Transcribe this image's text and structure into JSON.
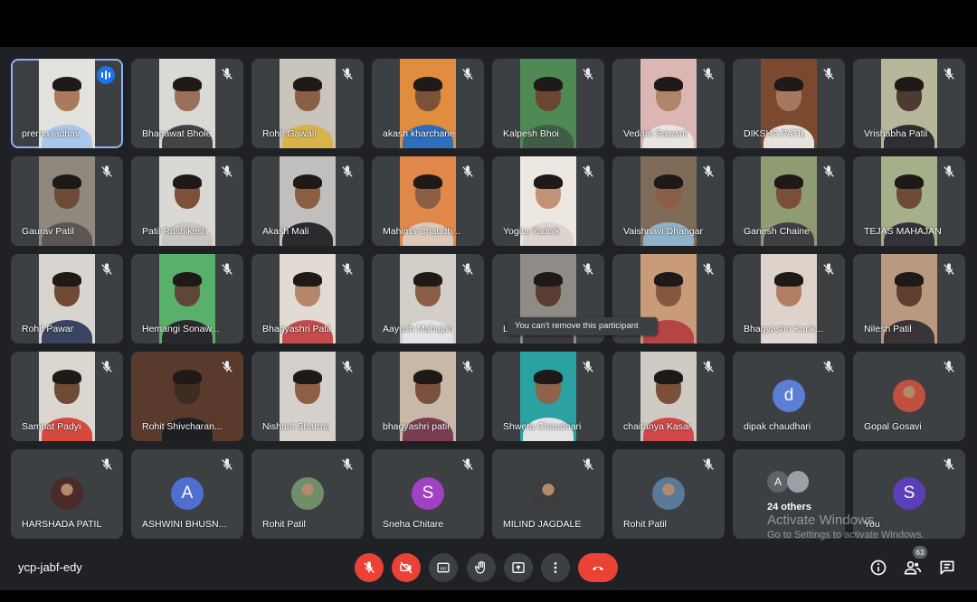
{
  "meeting": {
    "code": "ycp-jabf-edy",
    "participant_count": "63",
    "tooltip": "You can't remove this participant"
  },
  "colors": {
    "background": "#202124",
    "tile": "#3c4043",
    "active_outline": "#8ab4f8",
    "end_call": "#ea4335"
  },
  "tiles": [
    {
      "name": "prerna jadhav",
      "kind": "video",
      "speaking": true,
      "bg": "#e4e2df",
      "skin": "#a97b5c",
      "shirt": "#a9c7ea"
    },
    {
      "name": "Bhagawat Bhole",
      "kind": "video",
      "bg": "#d9dad6",
      "skin": "#9b7058",
      "shirt": "#444447"
    },
    {
      "name": "Rohit Gawali",
      "kind": "video",
      "bg": "#c9c4bc",
      "skin": "#8a5f46",
      "shirt": "#d8b24b"
    },
    {
      "name": "akash kharchane",
      "kind": "video",
      "bg": "#e08d3f",
      "skin": "#7c5136",
      "shirt": "#2d6fbd"
    },
    {
      "name": "Kalpesh Bhoi",
      "kind": "video",
      "bg": "#4f8a55",
      "skin": "#6b4632",
      "shirt": "#3f5e45"
    },
    {
      "name": "Vedant Sawant",
      "kind": "video",
      "bg": "#dbb6b2",
      "skin": "#b08467",
      "shirt": "#e8e4e1"
    },
    {
      "name": "DIKSHA PATIL",
      "kind": "video",
      "bg": "#7b4a2e",
      "skin": "#a5795e",
      "shirt": "#e7e2dd"
    },
    {
      "name": "Vrishabha Patil",
      "kind": "video",
      "bg": "#b7b79b",
      "skin": "#4c3a33",
      "shirt": "#2f2f33"
    },
    {
      "name": "Gaurav Patil",
      "kind": "video",
      "bg": "#8f887f",
      "skin": "#6e4a39",
      "shirt": "#5b5653"
    },
    {
      "name": "Patil Rushikesh",
      "kind": "video",
      "bg": "#d9d8d4",
      "skin": "#7b5139",
      "shirt": "#c9c6c1"
    },
    {
      "name": "Akash Mali",
      "kind": "video",
      "bg": "#c1bfbd",
      "skin": "#8b5d42",
      "shirt": "#2a2a2f"
    },
    {
      "name": "Mahima Chaudh...",
      "kind": "video",
      "bg": "#e0874a",
      "skin": "#8b5f43",
      "shirt": "#d9c9bb"
    },
    {
      "name": "Yogita Yadnik",
      "kind": "video",
      "bg": "#ede7e2",
      "skin": "#c19273",
      "shirt": "#ddd3cf"
    },
    {
      "name": "Vaishnavi Dhangar",
      "kind": "video",
      "bg": "#7f6c58",
      "skin": "#8b5f46",
      "shirt": "#8fb2c8"
    },
    {
      "name": "Ganesh Chaine",
      "kind": "video",
      "bg": "#8f9b72",
      "skin": "#7a4f38",
      "shirt": "#404044"
    },
    {
      "name": "TEJAS MAHAJAN",
      "kind": "video",
      "bg": "#a5b08a",
      "skin": "#6e4b39",
      "shirt": "#33343a"
    },
    {
      "name": "Rohit Pawar",
      "kind": "video",
      "bg": "#d8d5d1",
      "skin": "#704a35",
      "shirt": "#394461"
    },
    {
      "name": "Hemangi Sonaw...",
      "kind": "video",
      "bg": "#59b06a",
      "skin": "#5f4637",
      "shirt": "#2a2a2e"
    },
    {
      "name": "Bhagyashri Patil",
      "kind": "video",
      "bg": "#e2dad3",
      "skin": "#b4876a",
      "shirt": "#c44b4a"
    },
    {
      "name": "Aayush Mahajan",
      "kind": "video",
      "bg": "#d3cfc8",
      "skin": "#8a5d44",
      "shirt": "#e2e3e6"
    },
    {
      "name": "L",
      "kind": "video",
      "bg": "#8f8c87",
      "skin": "#5a3e31",
      "shirt": "#3a3a3e"
    },
    {
      "name": "ini Patil",
      "kind": "video",
      "bg": "#c99b79",
      "skin": "#85573f",
      "shirt": "#b54545"
    },
    {
      "name": "Bhagyashri Kank...",
      "kind": "video",
      "bg": "#ded3ca",
      "skin": "#b07f63",
      "shirt": "#e0d7d3"
    },
    {
      "name": "Nilesh Patil",
      "kind": "video",
      "bg": "#b99a80",
      "skin": "#5f4030",
      "shirt": "#3a3437"
    },
    {
      "name": "Sampat Padyi",
      "kind": "video",
      "bg": "#dcd6d1",
      "skin": "#6f4a37",
      "shirt": "#d6493e"
    },
    {
      "name": "Rohit Shivcharan...",
      "kind": "video",
      "full": true,
      "bg": "#5a3a2c",
      "skin": "#3e2b22",
      "shirt": "#1f1f22"
    },
    {
      "name": "Nishant Sharma",
      "kind": "video",
      "bg": "#d4d0cb",
      "skin": "#8d5f44",
      "shirt": "#d7d2cc"
    },
    {
      "name": "bhagyashri patil",
      "kind": "video",
      "bg": "#c8b8a7",
      "skin": "#7a513b",
      "shirt": "#7a3d52"
    },
    {
      "name": "Shweta Chaudhari",
      "kind": "video",
      "bg": "#2aa2a2",
      "skin": "#8f634a",
      "shirt": "#e3e3e3"
    },
    {
      "name": "chaitanya Kasar",
      "kind": "video",
      "bg": "#cfcac3",
      "skin": "#7b503a",
      "shirt": "#d2474a"
    },
    {
      "name": "dipak chaudhari",
      "kind": "letter",
      "letter": "d",
      "color": "#5c7fd6"
    },
    {
      "name": "Gopal Gosavi",
      "kind": "photo",
      "color": "#c0513f"
    },
    {
      "name": "HARSHADA PATIL",
      "kind": "photo",
      "color": "#4a2a2a"
    },
    {
      "name": "ASHWINI BHUSN...",
      "kind": "letter",
      "letter": "A",
      "color": "#4f6fd0"
    },
    {
      "name": "Rohit Patil",
      "kind": "photo",
      "color": "#6f8f6a"
    },
    {
      "name": "Sneha Chitare",
      "kind": "letter",
      "letter": "S",
      "color": "#a142c4"
    },
    {
      "name": "MILIND JAGDALE",
      "kind": "photo",
      "color": "#3d3d40"
    },
    {
      "name": "Rohit Patil",
      "kind": "photo",
      "color": "#5a7a9a"
    },
    {
      "name": "24 others",
      "kind": "others",
      "letter": "A"
    },
    {
      "name": "You",
      "kind": "letter",
      "letter": "S",
      "color": "#5b3fb8"
    }
  ],
  "watermark": {
    "line1": "Activate Windows",
    "line2": "Go to Settings to activate Windows."
  },
  "controls": [
    {
      "name": "mic-button",
      "icon": "mic-off-icon",
      "red": true
    },
    {
      "name": "camera-button",
      "icon": "camera-off-icon",
      "red": true
    },
    {
      "name": "captions-button",
      "icon": "captions-icon"
    },
    {
      "name": "raise-hand-button",
      "icon": "hand-icon"
    },
    {
      "name": "present-button",
      "icon": "present-icon"
    },
    {
      "name": "more-options-button",
      "icon": "more-vert-icon"
    },
    {
      "name": "leave-call-button",
      "icon": "end-call-icon",
      "end": true
    }
  ],
  "right_controls": [
    {
      "name": "meeting-info-button",
      "icon": "info-icon"
    },
    {
      "name": "people-button",
      "icon": "people-icon"
    },
    {
      "name": "chat-button",
      "icon": "chat-icon"
    }
  ]
}
